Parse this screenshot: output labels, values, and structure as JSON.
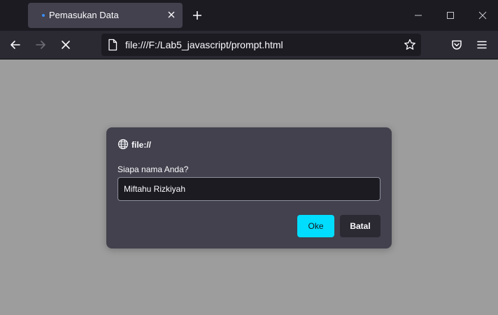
{
  "browser": {
    "tab": {
      "title": "Pemasukan Data"
    },
    "url": "file:///F:/Lab5_javascript/prompt.html"
  },
  "dialog": {
    "origin": "file://",
    "message": "Siapa nama Anda?",
    "input_value": "Miftahu Rizkiyah",
    "ok_label": "Oke",
    "cancel_label": "Batal"
  },
  "colors": {
    "page_background": "#9d9d9d",
    "tabbar": "#1c1b22",
    "toolbar": "#2b2a33",
    "dialog": "#42414d",
    "accent": "#00ddff",
    "tab_loading_dot": "#3b8ef5"
  },
  "icons": [
    "tab-close-icon",
    "plus-icon",
    "minimize-icon",
    "maximize-icon",
    "window-close-icon",
    "back-arrow-icon",
    "forward-arrow-icon",
    "stop-loading-icon",
    "page-icon",
    "bookmark-star-icon",
    "pocket-icon",
    "hamburger-menu-icon",
    "globe-icon"
  ]
}
